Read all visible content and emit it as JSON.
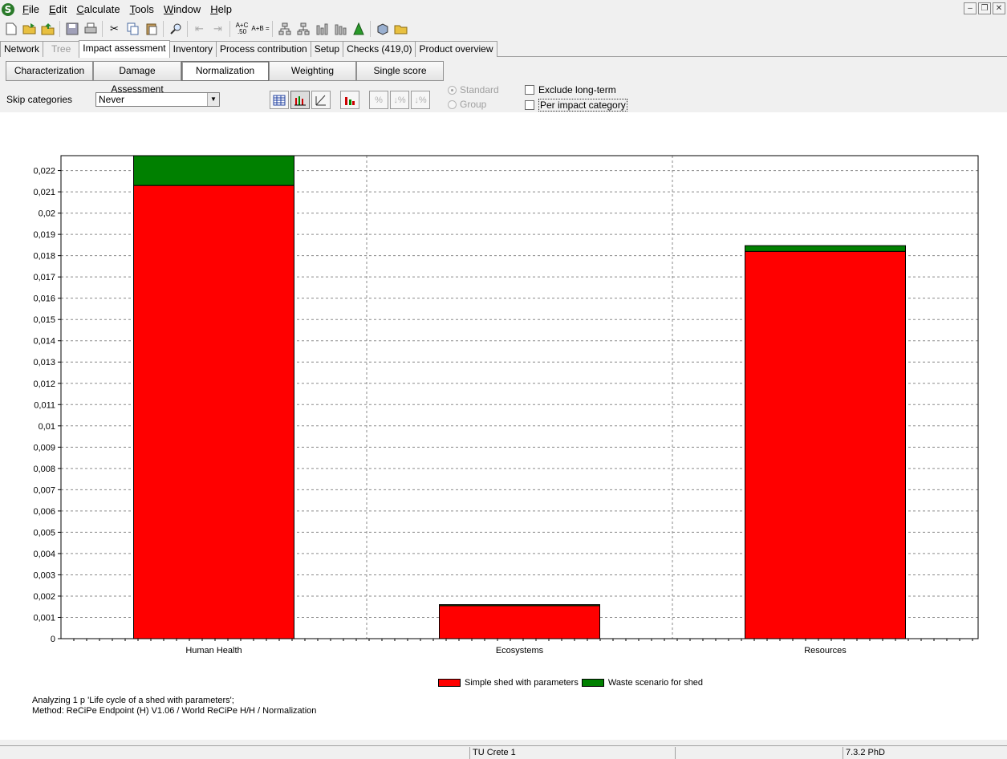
{
  "menu": {
    "items": [
      "File",
      "Edit",
      "Calculate",
      "Tools",
      "Window",
      "Help"
    ]
  },
  "toolbar": {
    "icons": [
      "new-icon",
      "open-icon",
      "import-icon",
      "save-icon",
      "print-icon",
      "cut-icon",
      "copy-icon",
      "paste-icon",
      "search-icon",
      "back-icon",
      "forward-icon",
      "calc-a-icon",
      "calc-b-icon",
      "network-icon",
      "tree-icon",
      "bar-chart-icon",
      "stacked-chart-icon",
      "tree-chart-icon",
      "box-icon",
      "folder-icon"
    ],
    "calc_a_label": "A+C .50",
    "calc_b_label": "A+B ="
  },
  "tabs": [
    {
      "label": "Network",
      "state": "normal"
    },
    {
      "label": "Tree",
      "state": "disabled"
    },
    {
      "label": "Impact assessment",
      "state": "active"
    },
    {
      "label": "Inventory",
      "state": "normal"
    },
    {
      "label": "Process contribution",
      "state": "normal"
    },
    {
      "label": "Setup",
      "state": "normal"
    },
    {
      "label": "Checks (419,0)",
      "state": "normal"
    },
    {
      "label": "Product overview",
      "state": "normal"
    }
  ],
  "subtabs": [
    {
      "label": "Characterization",
      "active": false
    },
    {
      "label": "Damage Assessment",
      "active": false
    },
    {
      "label": "Normalization",
      "active": true
    },
    {
      "label": "Weighting",
      "active": false
    },
    {
      "label": "Single score",
      "active": false
    }
  ],
  "controls": {
    "skip_label": "Skip categories",
    "skip_value": "Never",
    "radio_standard": "Standard",
    "radio_group": "Group",
    "check_exclude": "Exclude long-term",
    "check_per_category": "Per impact category"
  },
  "chart_data": {
    "type": "bar",
    "stacked": true,
    "categories": [
      "Human Health",
      "Ecosystems",
      "Resources"
    ],
    "series": [
      {
        "name": "Simple shed with parameters",
        "color": "#ff0000",
        "values": [
          0.0213,
          0.00155,
          0.0182
        ]
      },
      {
        "name": "Waste scenario for shed",
        "color": "#008000",
        "values": [
          0.0014,
          5e-05,
          0.00027
        ]
      }
    ],
    "ylim": [
      0,
      0.0227
    ],
    "yticks": [
      "0",
      "0,001",
      "0,002",
      "0,003",
      "0,004",
      "0,005",
      "0,006",
      "0,007",
      "0,008",
      "0,009",
      "0,01",
      "0,011",
      "0,012",
      "0,013",
      "0,014",
      "0,015",
      "0,016",
      "0,017",
      "0,018",
      "0,019",
      "0,02",
      "0,021",
      "0,022"
    ],
    "grid": true,
    "legend": "bottom-center"
  },
  "analysis": {
    "line1": "Analyzing 1 p 'Life cycle of a shed with parameters';",
    "line2": "Method: ReCiPe Endpoint (H) V1.06 / World ReCiPe H/H / Normalization"
  },
  "status": {
    "project": "TU Crete 1",
    "version": "7.3.2 PhD"
  }
}
